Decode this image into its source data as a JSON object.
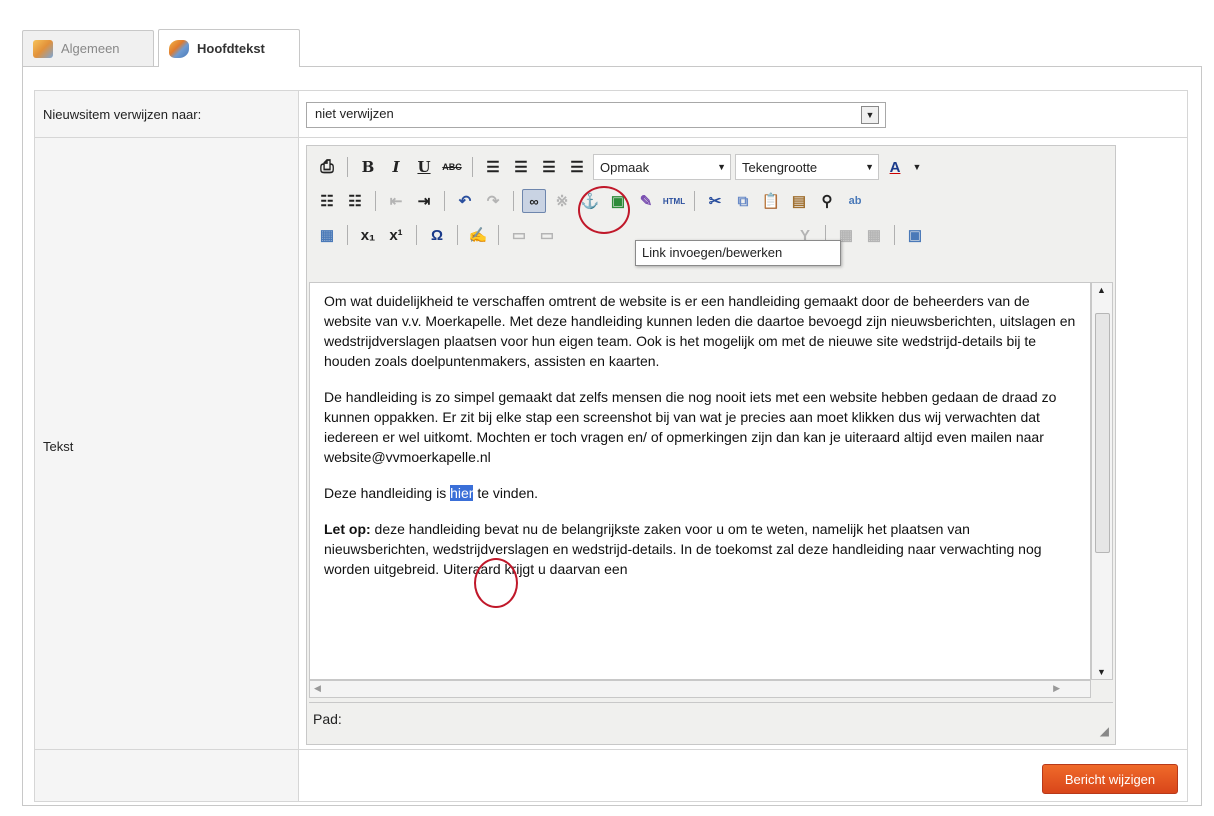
{
  "tabs": [
    {
      "label": "Algemeen",
      "active": false
    },
    {
      "label": "Hoofdtekst",
      "active": true
    }
  ],
  "form": {
    "redirect_label": "Nieuwsitem verwijzen naar:",
    "redirect_value": "niet verwijzen",
    "text_label": "Tekst"
  },
  "toolbar": {
    "format_dropdown": "Opmaak",
    "fontsize_dropdown": "Tekengrootte",
    "tooltip": "Link invoegen/bewerken"
  },
  "content": {
    "p1": "Om wat duidelijkheid te verschaffen omtrent de website is er een handleiding gemaakt door de beheerders van de website van v.v. Moerkapelle. Met deze handleiding kunnen leden die daartoe bevoegd zijn nieuwsberichten, uitslagen en wedstrijdverslagen plaatsen voor hun eigen team. Ook is het mogelijk om met de nieuwe site wedstrijd-details bij te houden zoals doelpuntenmakers, assisten en kaarten.",
    "p2": "De handleiding is zo simpel gemaakt dat zelfs mensen die nog nooit iets met een website hebben gedaan de draad zo kunnen oppakken. Er zit bij elke stap een screenshot bij van wat je precies aan moet klikken dus wij verwachten dat iedereen er wel uitkomt. Mochten er toch vragen en/ of opmerkingen zijn dan kan je uiteraard altijd even mailen naar website@vvmoerkapelle.nl",
    "p3_before": "Deze handleiding is ",
    "p3_selected": "hier",
    "p3_after": " te vinden.",
    "p4_bold": "Let op:",
    "p4_rest": " deze handleiding bevat nu de belangrijkste zaken voor u om te weten, namelijk het plaatsen van nieuwsberichten, wedstrijdverslagen en wedstrijd-details. In de toekomst zal deze handleiding naar verwachting nog worden uitgebreid. Uiteraard krijgt u daarvan een"
  },
  "pathbar": {
    "label": "Pad:"
  },
  "submit": {
    "label": "Bericht wijzigen"
  },
  "colors": {
    "accent": "#e2531f",
    "selection": "#3a6fd8",
    "annotation": "#c0182a"
  }
}
